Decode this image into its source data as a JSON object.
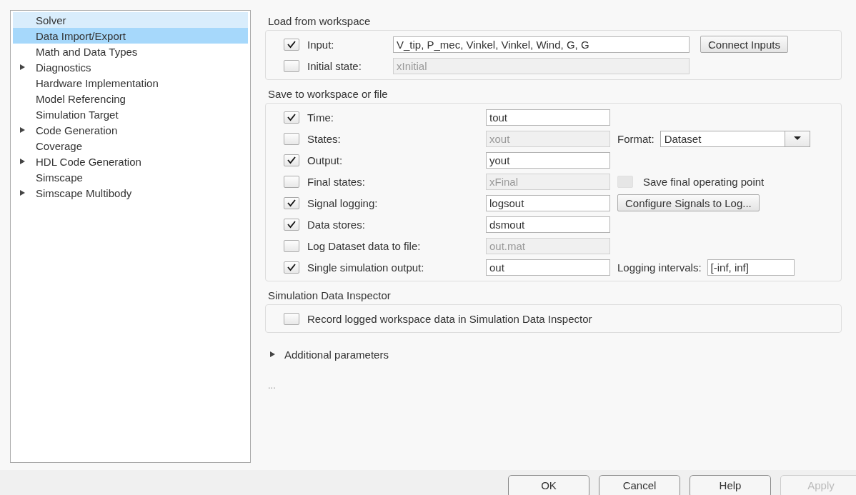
{
  "sidebar": {
    "items": [
      {
        "label": "Solver",
        "has_children": false,
        "selected": false,
        "hovered": true
      },
      {
        "label": "Data Import/Export",
        "has_children": false,
        "selected": true,
        "hovered": false
      },
      {
        "label": "Math and Data Types",
        "has_children": false,
        "selected": false,
        "hovered": false
      },
      {
        "label": "Diagnostics",
        "has_children": true,
        "selected": false,
        "hovered": false
      },
      {
        "label": "Hardware Implementation",
        "has_children": false,
        "selected": false,
        "hovered": false
      },
      {
        "label": "Model Referencing",
        "has_children": false,
        "selected": false,
        "hovered": false
      },
      {
        "label": "Simulation Target",
        "has_children": false,
        "selected": false,
        "hovered": false
      },
      {
        "label": "Code Generation",
        "has_children": true,
        "selected": false,
        "hovered": false
      },
      {
        "label": "Coverage",
        "has_children": false,
        "selected": false,
        "hovered": false
      },
      {
        "label": "HDL Code Generation",
        "has_children": true,
        "selected": false,
        "hovered": false
      },
      {
        "label": "Simscape",
        "has_children": false,
        "selected": false,
        "hovered": false
      },
      {
        "label": "Simscape Multibody",
        "has_children": true,
        "selected": false,
        "hovered": false
      }
    ]
  },
  "load_from_workspace": {
    "title": "Load from workspace",
    "rows": [
      {
        "label": "Input:",
        "checked": true,
        "value": "V_tip, P_mec, Vinkel, Vinkel, Wind, G, G",
        "disabled": false,
        "extra": {
          "kind": "button",
          "label": "Connect Inputs"
        }
      },
      {
        "label": "Initial state:",
        "checked": false,
        "value": "xInitial",
        "disabled": true
      }
    ]
  },
  "save_to_workspace": {
    "title": "Save to workspace or file",
    "rows": [
      {
        "label": "Time:",
        "checked": true,
        "value": "tout",
        "disabled": false
      },
      {
        "label": "States:",
        "checked": false,
        "value": "xout",
        "disabled": true,
        "extra": {
          "kind": "dropdown",
          "label": "Format:",
          "value": "Dataset"
        }
      },
      {
        "label": "Output:",
        "checked": true,
        "value": "yout",
        "disabled": false
      },
      {
        "label": "Final states:",
        "checked": false,
        "value": "xFinal",
        "disabled": true,
        "extra": {
          "kind": "checkbox",
          "label": "Save final operating point",
          "checked": false,
          "disabled": true
        }
      },
      {
        "label": "Signal logging:",
        "checked": true,
        "value": "logsout",
        "disabled": false,
        "extra": {
          "kind": "button",
          "label": "Configure Signals to Log..."
        }
      },
      {
        "label": "Data stores:",
        "checked": true,
        "value": "dsmout",
        "disabled": false
      },
      {
        "label": "Log Dataset data to file:",
        "checked": false,
        "value": "out.mat",
        "disabled": true
      },
      {
        "label": "Single simulation output:",
        "checked": true,
        "value": "out",
        "disabled": false,
        "extra": {
          "kind": "field",
          "label": "Logging intervals:",
          "value": "[-inf, inf]"
        }
      }
    ]
  },
  "simulation_data_inspector": {
    "title": "Simulation Data Inspector",
    "checkbox": {
      "label": "Record logged workspace data in Simulation Data Inspector",
      "checked": false
    }
  },
  "additional_parameters": {
    "label": "Additional parameters",
    "expanded": false
  },
  "ellipsis": "...",
  "buttons": [
    {
      "label": "OK",
      "disabled": false
    },
    {
      "label": "Cancel",
      "disabled": false
    },
    {
      "label": "Help",
      "disabled": false
    },
    {
      "label": "Apply",
      "disabled": true
    }
  ]
}
